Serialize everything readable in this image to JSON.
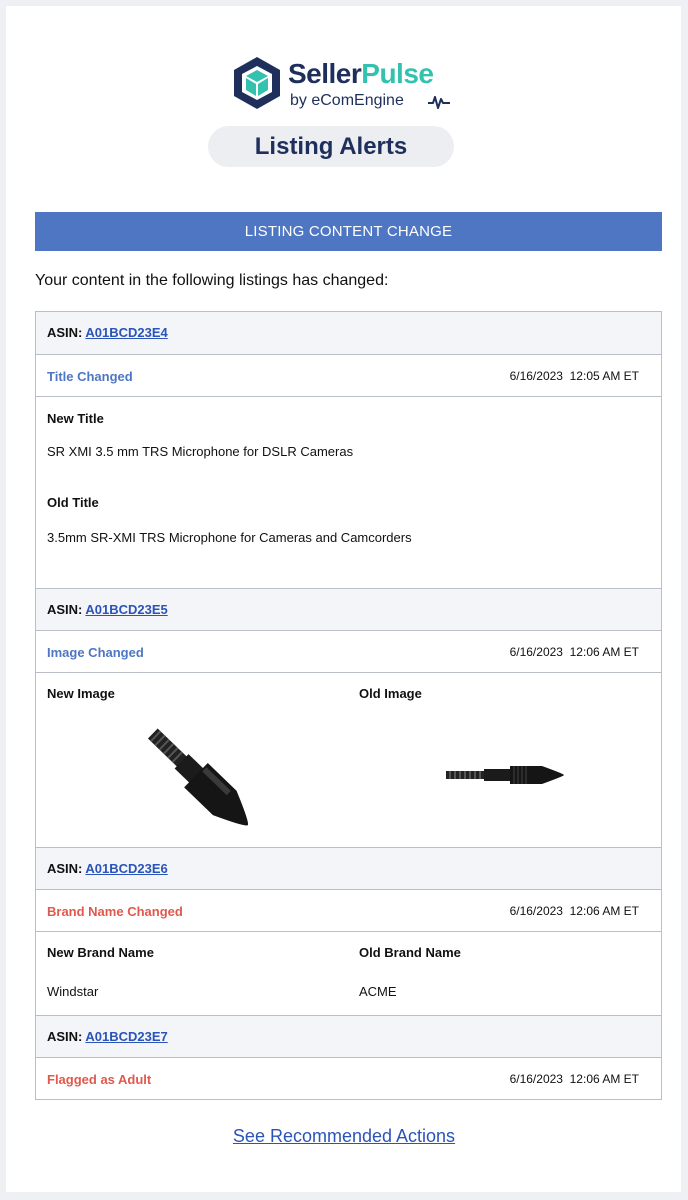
{
  "brand": {
    "name_part1": "Seller",
    "name_part2": "Pulse",
    "tagline": "by eComEngine",
    "colors": {
      "navy": "#1f2f5c",
      "teal": "#33c2ad"
    }
  },
  "header": {
    "pill_title": "Listing Alerts"
  },
  "banner": {
    "label": "LISTING CONTENT CHANGE",
    "color": "#4f76c3"
  },
  "intro": "Your content in the following listings has changed:",
  "alerts": [
    {
      "asin_label": "ASIN:",
      "asin": "A01BCD23E4",
      "change": "Title Changed",
      "date": "6/16/2023  12:05 AM ET",
      "new_label": "New Title",
      "new_value": "SR XMI 3.5 mm TRS Microphone for DSLR Cameras",
      "old_label": "Old Title",
      "old_value": "3.5mm SR-XMI TRS Microphone for Cameras and Camcorders"
    },
    {
      "asin_label": "ASIN:",
      "asin": "A01BCD23E5",
      "change": "Image Changed",
      "date": "6/16/2023  12:06 AM ET",
      "new_label": "New Image",
      "old_label": "Old Image"
    },
    {
      "asin_label": "ASIN:",
      "asin": "A01BCD23E6",
      "change": "Brand Name Changed",
      "date": "6/16/2023  12:06 AM ET",
      "new_label": "New Brand Name",
      "new_value": "Windstar",
      "old_label": "Old Brand Name",
      "old_value": "ACME"
    },
    {
      "asin_label": "ASIN:",
      "asin": "A01BCD23E7",
      "change": "Flagged as Adult",
      "date": "6/16/2023  12:06 AM ET"
    }
  ],
  "footer": {
    "link": "See Recommended Actions"
  }
}
